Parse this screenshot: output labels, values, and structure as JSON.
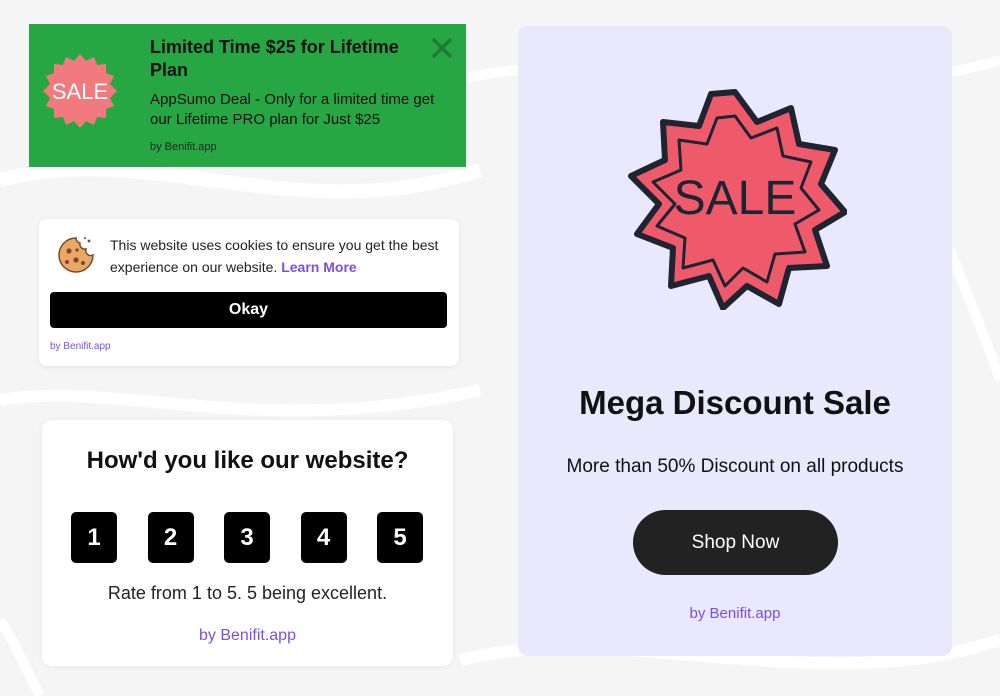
{
  "deal_banner": {
    "badge_text": "SALE",
    "title": "Limited Time $25 for Lifetime Plan",
    "body": "AppSumo Deal - Only for a limited time get our Lifetime PRO plan for Just $25",
    "by": "by Benifit.app",
    "close_icon": "close-icon",
    "colors": {
      "background": "#27a744",
      "badge": "#f27a7e"
    }
  },
  "cookie_notice": {
    "icon": "cookie-icon",
    "message": "This website uses cookies to ensure you get the best experience on our website.",
    "learn_more": "Learn More",
    "button_label": "Okay",
    "by": "by Benifit.app",
    "colors": {
      "link": "#7c4ee4",
      "button": "#000000"
    }
  },
  "rating_widget": {
    "title": "How'd you like our website?",
    "options": [
      "1",
      "2",
      "3",
      "4",
      "5"
    ],
    "hint": "Rate from 1 to 5. 5 being excellent.",
    "by": "by Benifit.app"
  },
  "sale_card": {
    "badge_text": "SALE",
    "title": "Mega Discount Sale",
    "subtitle": "More than 50% Discount on all products",
    "button_label": "Shop Now",
    "by": "by Benifit.app",
    "colors": {
      "background": "#e9e8fd",
      "badge": "#ef5a6b",
      "button": "#222222"
    }
  }
}
